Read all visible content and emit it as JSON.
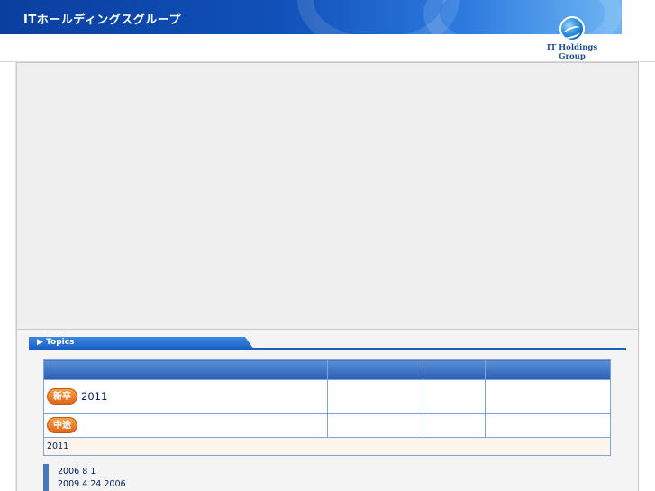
{
  "header": {
    "title": "ITホールディングスグループ",
    "logo_line1": "IT Holdings",
    "logo_line2": "Group"
  },
  "topics": {
    "tab_label": "Topics",
    "tab_marker": "▶"
  },
  "jobs_table": {
    "columns": [
      "",
      "",
      "",
      ""
    ],
    "rows": [
      {
        "badge": "新卒",
        "line1": "2011",
        "line2": ""
      },
      {
        "badge": "中途",
        "line1": " ",
        "line2": ""
      }
    ],
    "note": "2011 "
  },
  "news": [
    {
      "text": "2006 8 1"
    },
    {
      "text": "2009 4 24 2006"
    }
  ],
  "colors": {
    "header_blue": "#1150b8",
    "topics_blue": "#1a5fc4",
    "badge_orange": "#e0661a",
    "panel_grey": "#efefef"
  }
}
